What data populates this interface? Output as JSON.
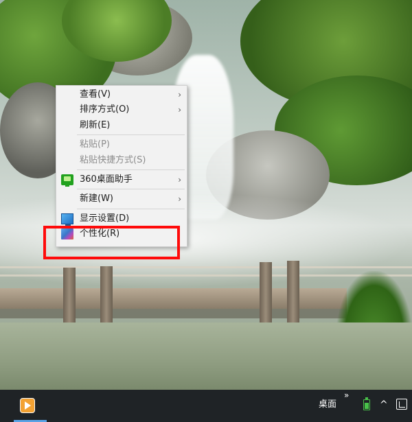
{
  "context_menu": {
    "items": [
      {
        "label": "查看(V)",
        "submenu": true,
        "disabled": false
      },
      {
        "label": "排序方式(O)",
        "submenu": true,
        "disabled": false
      },
      {
        "label": "刷新(E)",
        "submenu": false,
        "disabled": false
      },
      {
        "label": "粘贴(P)",
        "submenu": false,
        "disabled": true
      },
      {
        "label": "粘贴快捷方式(S)",
        "submenu": false,
        "disabled": true
      },
      {
        "label": "360桌面助手",
        "submenu": true,
        "disabled": false,
        "icon": "360-desktop-assistant-icon"
      },
      {
        "label": "新建(W)",
        "submenu": true,
        "disabled": false
      },
      {
        "label": "显示设置(D)",
        "submenu": false,
        "disabled": false,
        "icon": "display-settings-icon"
      },
      {
        "label": "个性化(R)",
        "submenu": false,
        "disabled": false,
        "icon": "personalize-icon"
      }
    ],
    "submenu_arrow": "›"
  },
  "highlight": {
    "target": "个性化(R)",
    "color": "#ff0a0a"
  },
  "taskbar": {
    "app_icon": "media-player-icon",
    "desktop_label": "桌面",
    "overflow_glyph": "»",
    "tray_up_glyph": "^",
    "tray_icons": [
      "battery-icon",
      "caret-up-icon",
      "input-method-icon"
    ]
  },
  "colors": {
    "menu_background": "#f2f2f2",
    "taskbar_background": "#1f2326",
    "highlight_border": "#ff0a0a"
  }
}
